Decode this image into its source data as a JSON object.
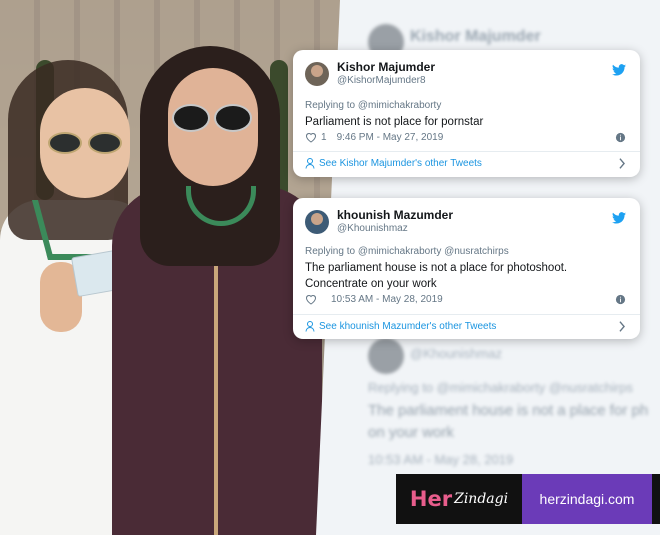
{
  "background_ghost": {
    "name": "Kishor Majumder",
    "handle": "@Khounishmaz",
    "replying": "Replying to @mimichakraborty @nusratchirps",
    "text_line1": "The parliament house is not a place for ph",
    "text_line2": "on your work",
    "time": "10:53 AM - May 28, 2019"
  },
  "tweets": [
    {
      "name": "Kishor Majumder",
      "handle": "@KishorMajumder8",
      "replying_prefix": "Replying to",
      "replying_to": "@mimichakraborty",
      "text": "Parliament is not place for pornstar",
      "likes": "1",
      "timestamp": "9:46 PM - May 27, 2019",
      "see_more": "See Kishor Majumder's other Tweets"
    },
    {
      "name": "khounish Mazumder",
      "handle": "@Khounishmaz",
      "replying_prefix": "Replying to",
      "replying_to": "@mimichakraborty @nusratchirps",
      "text": "The parliament house is not a place for photoshoot. Concentrate on your work",
      "likes": "",
      "timestamp": "10:53 AM - May 28, 2019",
      "see_more": "See khounish Mazumder's other Tweets"
    }
  ],
  "brand": {
    "logo_her": "Her",
    "logo_zindagi": "Zindagi",
    "site": "herzindagi.com",
    "colors": {
      "logo_bg": "#111111",
      "site_bg": "#6b3bb8",
      "her": "#e85d8c"
    }
  },
  "colors": {
    "twitter_blue": "#1da1f2",
    "link_blue": "#1b95e0",
    "muted": "#657786"
  }
}
